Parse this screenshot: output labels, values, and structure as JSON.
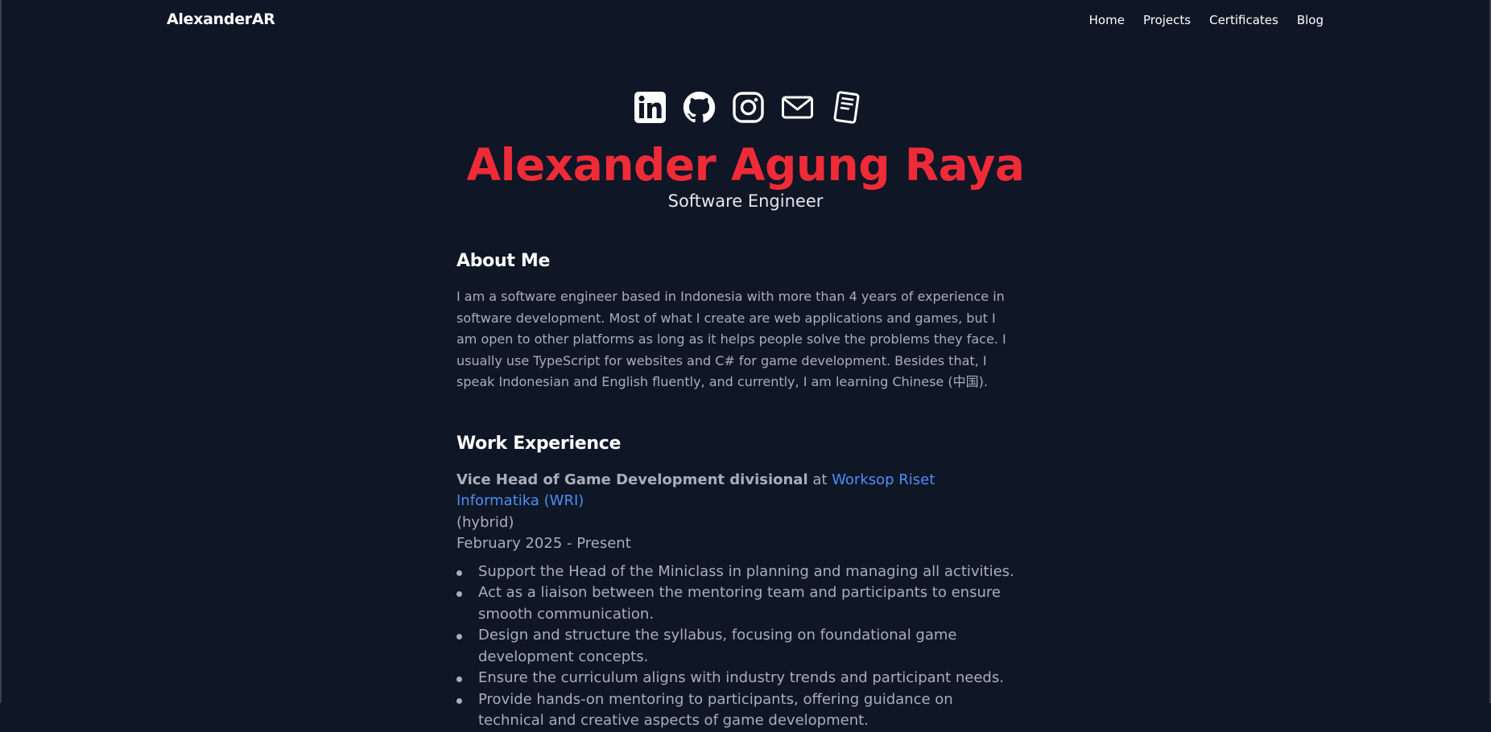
{
  "nav": {
    "brand": "AlexanderAR",
    "links": [
      "Home",
      "Projects",
      "Certificates",
      "Blog"
    ]
  },
  "social_icons": [
    "linkedin-icon",
    "github-icon",
    "instagram-icon",
    "mail-icon",
    "document-icon"
  ],
  "hero": {
    "name": "Alexander Agung Raya",
    "role": "Software Engineer"
  },
  "about": {
    "title": "About Me",
    "text": "I am a software engineer based in Indonesia with more than 4 years of experience in software development. Most of what I create are web applications and games, but I am open to other platforms as long as it helps people solve the problems they face. I usually use TypeScript for websites and C# for game development. Besides that, I speak Indonesian and English fluently, and currently, I am learning Chinese (中国)."
  },
  "work": {
    "title": "Work Experience",
    "jobs": [
      {
        "position": "Vice Head of Game Development divisional",
        "at": " at ",
        "company": "Worksop Riset Informatika (WRI)",
        "mode": "(hybrid)",
        "period": "February 2025 - Present",
        "duties": [
          "Support the Head of the Miniclass in planning and managing all activities.",
          "Act as a liaison between the mentoring team and participants to ensure smooth communication.",
          "Design and structure the syllabus, focusing on foundational game development concepts.",
          "Ensure the curriculum aligns with industry trends and participant needs.",
          "Provide hands-on mentoring to participants, offering guidance on technical and creative aspects of game development."
        ]
      }
    ]
  },
  "colors": {
    "background": "#0f1626",
    "accent": "#ef2b38",
    "link": "#4b8ff5",
    "text": "#a9aeb8"
  }
}
